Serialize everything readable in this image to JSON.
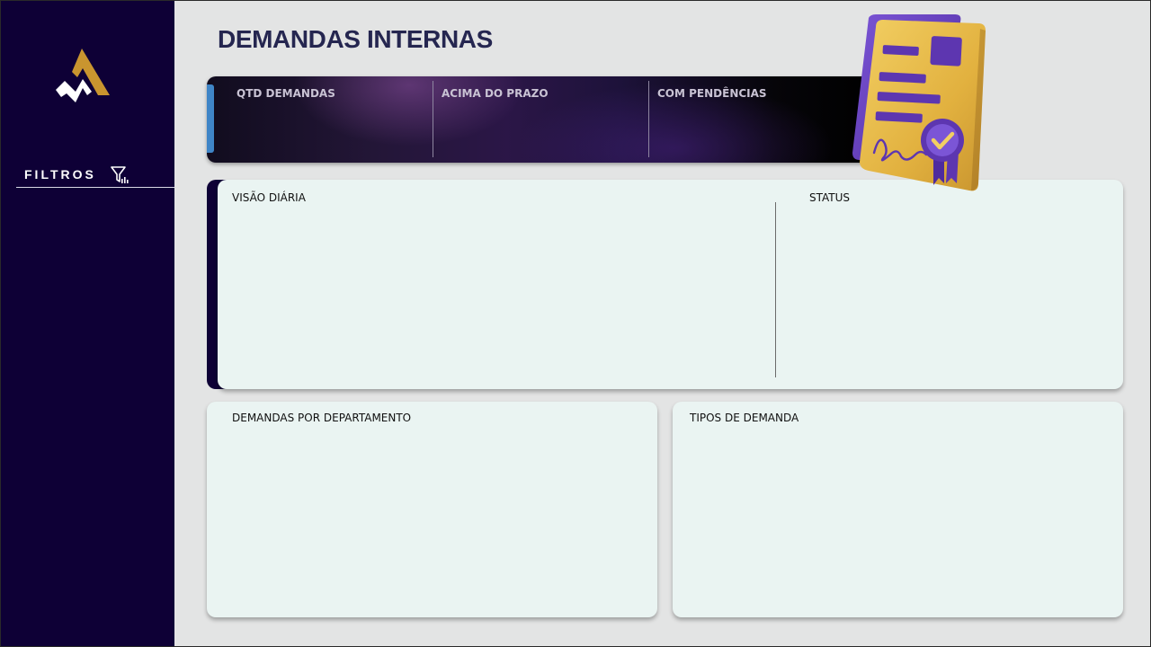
{
  "page": {
    "title": "DEMANDAS INTERNAS"
  },
  "sidebar": {
    "logo_icon": "brand-logo-icon",
    "filters_label": "FILTROS",
    "filters_icon": "filter-icon"
  },
  "kpis": [
    {
      "label": "QTD DEMANDAS"
    },
    {
      "label": "ACIMA DO PRAZO"
    },
    {
      "label": "COM PENDÊNCIAS"
    }
  ],
  "cards": {
    "daily_view": {
      "title": "VISÃO DIÁRIA"
    },
    "status": {
      "title": "STATUS"
    },
    "by_department": {
      "title": "DEMANDAS POR DEPARTAMENTO"
    },
    "demand_types": {
      "title": "TIPOS DE DEMANDA"
    }
  },
  "illustration": {
    "icon": "certificate-icon"
  },
  "colors": {
    "sidebar": "#0e0036",
    "title": "#252650",
    "accent_gold": "#c9952f",
    "accent_purple": "#5d36b0",
    "card_background": "#eaf4f2",
    "kpi_accent": "#3f85c7"
  }
}
